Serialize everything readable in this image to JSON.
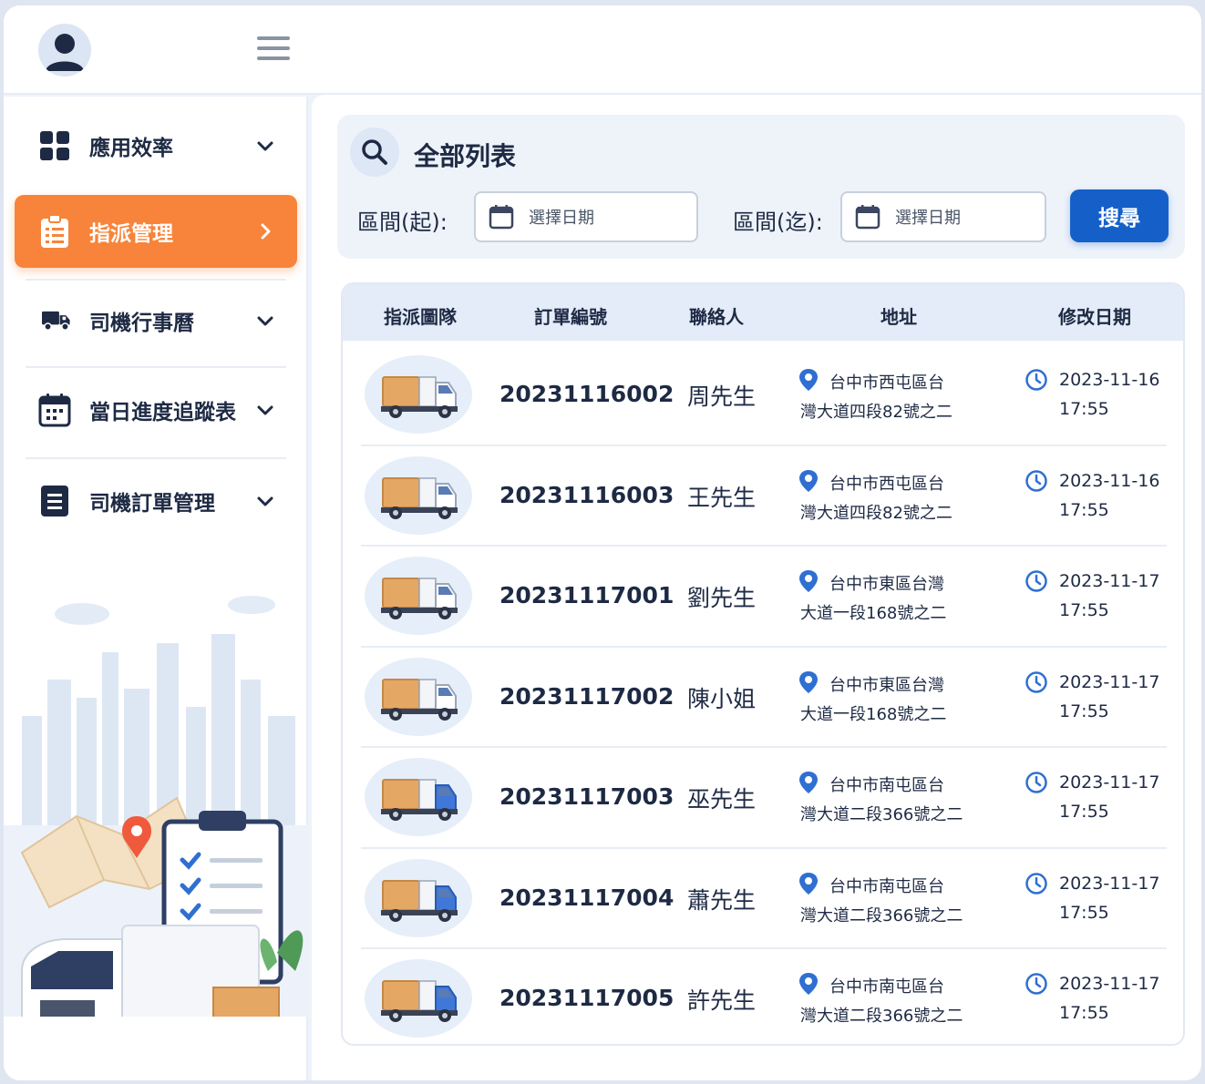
{
  "sidebar": {
    "items": [
      {
        "label": "應用效率",
        "icon": "grid-icon"
      },
      {
        "label": "指派管理",
        "icon": "clipboard-list-icon",
        "active": true
      },
      {
        "label": "司機行事曆",
        "icon": "truck-icon"
      },
      {
        "label": "當日進度追蹤表",
        "icon": "calendar-icon"
      },
      {
        "label": "司機訂單管理",
        "icon": "document-icon"
      }
    ]
  },
  "search": {
    "title": "全部列表",
    "start_label": "區間(起):",
    "end_label": "區間(迄):",
    "start_placeholder": "選擇日期",
    "end_placeholder": "選擇日期",
    "button_label": "搜尋"
  },
  "table": {
    "headers": [
      "指派圖隊",
      "訂單編號",
      "聯絡人",
      "地址",
      "修改日期"
    ],
    "rows": [
      {
        "order": "20231116002",
        "contact": "周先生",
        "addr1": "台中市西屯區台",
        "addr2": "灣大道四段82號之二",
        "date": "2023-11-16",
        "time": "17:55",
        "truck": "white"
      },
      {
        "order": "20231116003",
        "contact": "王先生",
        "addr1": "台中市西屯區台",
        "addr2": "灣大道四段82號之二",
        "date": "2023-11-16",
        "time": "17:55",
        "truck": "white"
      },
      {
        "order": "20231117001",
        "contact": "劉先生",
        "addr1": "台中市東區台灣",
        "addr2": "大道一段168號之二",
        "date": "2023-11-17",
        "time": "17:55",
        "truck": "white"
      },
      {
        "order": "20231117002",
        "contact": "陳小姐",
        "addr1": "台中市東區台灣",
        "addr2": "大道一段168號之二",
        "date": "2023-11-17",
        "time": "17:55",
        "truck": "white"
      },
      {
        "order": "20231117003",
        "contact": "巫先生",
        "addr1": "台中市南屯區台",
        "addr2": "灣大道二段366號之二",
        "date": "2023-11-17",
        "time": "17:55",
        "truck": "blue"
      },
      {
        "order": "20231117004",
        "contact": "蕭先生",
        "addr1": "台中市南屯區台",
        "addr2": "灣大道二段366號之二",
        "date": "2023-11-17",
        "time": "17:55",
        "truck": "blue"
      },
      {
        "order": "20231117005",
        "contact": "許先生",
        "addr1": "台中市南屯區台",
        "addr2": "灣大道二段366號之二",
        "date": "2023-11-17",
        "time": "17:55",
        "truck": "blue"
      }
    ]
  },
  "colors": {
    "accent_orange": "#f7843a",
    "primary_blue": "#1560c8",
    "navy": "#1e2a44",
    "pin_blue": "#2f6fd1"
  }
}
